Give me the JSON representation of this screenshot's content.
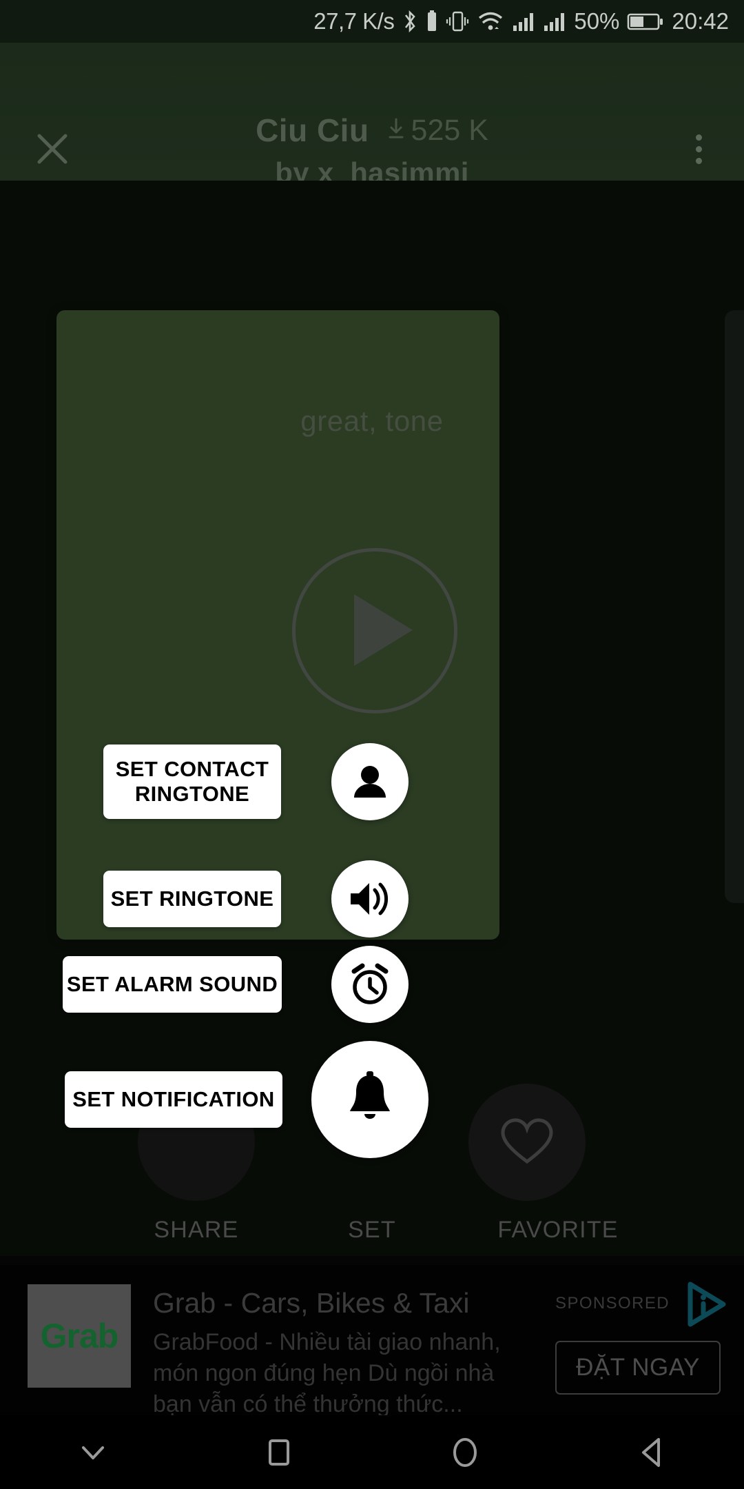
{
  "statusbar": {
    "network_speed": "27,7 K/s",
    "battery_percent": "50%",
    "clock": "20:42",
    "icons": [
      "bluetooth-icon",
      "vibrate-icon",
      "wifi-icon",
      "signal-bars-icon",
      "signal-bars-2-icon",
      "battery-icon"
    ]
  },
  "header": {
    "close_icon": "close-icon",
    "title": "Ciu Ciu",
    "download_icon": "download-icon",
    "download_count": "525 K",
    "author": "by x_hasimmi",
    "overflow_icon": "more-vertical-icon"
  },
  "card": {
    "label": "great, tone",
    "play_icon": "play-icon"
  },
  "actions": [
    {
      "label": "SET CONTACT RINGTONE",
      "icon": "person-icon",
      "name": "set-contact-ringtone"
    },
    {
      "label": "SET RINGTONE",
      "icon": "volume-up-icon",
      "name": "set-ringtone"
    },
    {
      "label": "SET ALARM SOUND",
      "icon": "alarm-clock-icon",
      "name": "set-alarm-sound"
    },
    {
      "label": "SET NOTIFICATION",
      "icon": "bell-icon",
      "name": "set-notification"
    }
  ],
  "bottom_bar": {
    "share_label": "SHARE",
    "set_label": "SET",
    "favorite_label": "FAVORITE",
    "favorite_icon": "heart-icon",
    "share_icon": "share-icon"
  },
  "ad": {
    "logo_text": "Grab",
    "title": "Grab - Cars, Bikes & Taxi",
    "body": "GrabFood - Nhiều tài giao nhanh, món ngon đúng hẹn Dù ngồi nhà bạn vẫn có thể thưởng thức...",
    "sponsored_label": "SPONSORED",
    "cta_label": "ĐẶT NGAY",
    "admob_icon": "admob-icon"
  },
  "navbar": {
    "items": [
      {
        "icon": "chevron-down-icon",
        "name": "nav-hide-keyboard"
      },
      {
        "icon": "square-icon",
        "name": "nav-recents"
      },
      {
        "icon": "circle-icon",
        "name": "nav-home"
      },
      {
        "icon": "triangle-back-icon",
        "name": "nav-back"
      }
    ]
  },
  "colors": {
    "card_green": "#2b3c23",
    "header_green": "#1e2d1c",
    "status_green": "#101a10",
    "accent_white": "#ffffff",
    "grab_green": "#14632f"
  }
}
